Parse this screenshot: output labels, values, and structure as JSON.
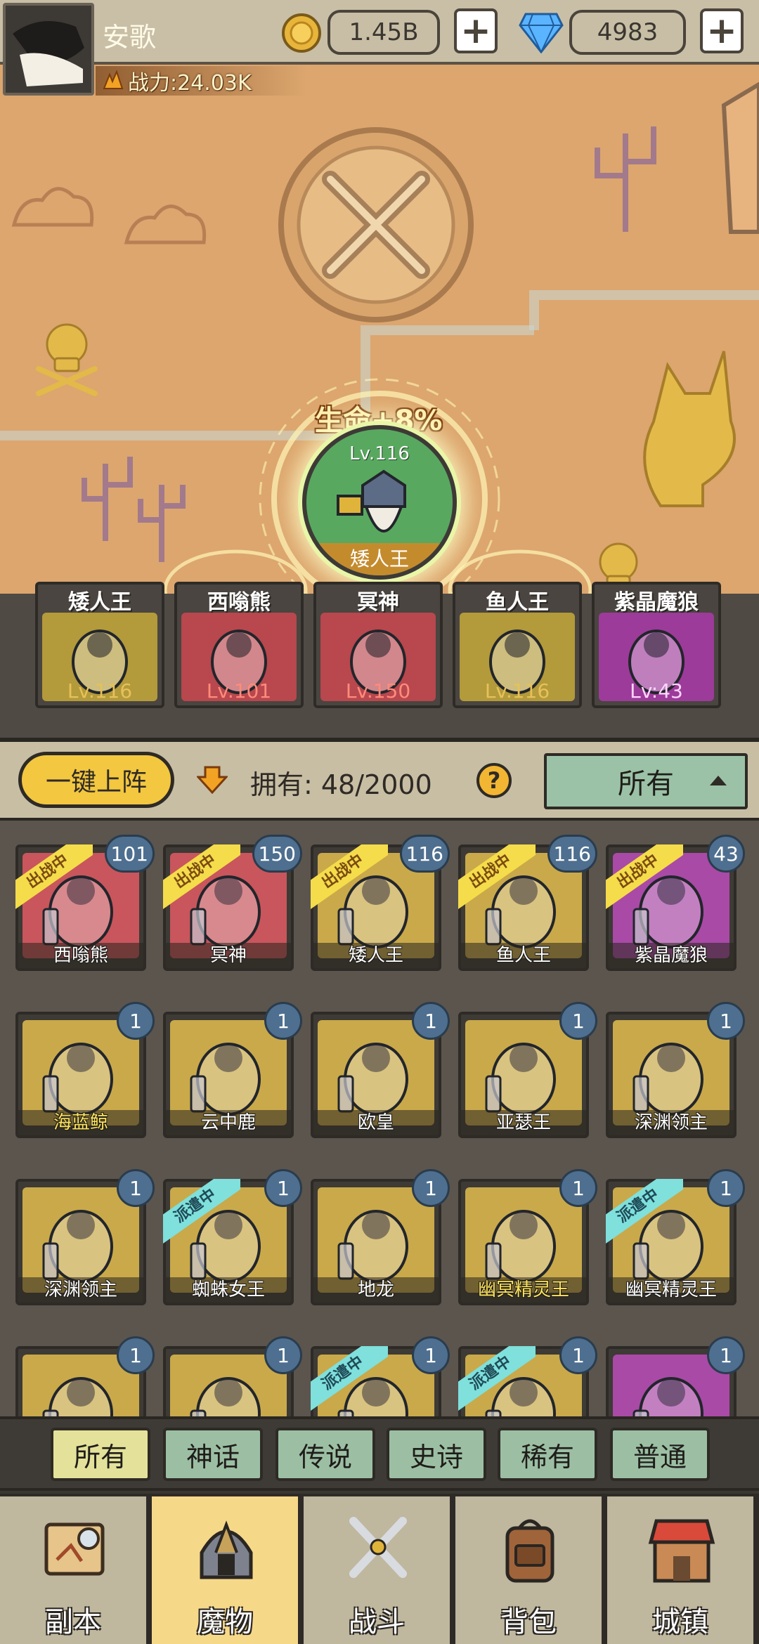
{
  "player": {
    "name": "安歌",
    "power": "战力:24.03K"
  },
  "currency": {
    "gold": "1.45B",
    "gems": "4983",
    "plus": "+"
  },
  "featured": {
    "bonus": "生命+8%",
    "level": "Lv.116",
    "name": "矮人王"
  },
  "team": [
    {
      "name": "矮人王",
      "level": "Lv.116",
      "color": "#b39a3a",
      "lvcolor": "#e6c15a"
    },
    {
      "name": "西嗡熊",
      "level": "Lv.101",
      "color": "#b8474e",
      "lvcolor": "#ff8b7a"
    },
    {
      "name": "冥神",
      "level": "Lv.150",
      "color": "#b8474e",
      "lvcolor": "#ff8b7a"
    },
    {
      "name": "鱼人王",
      "level": "Lv.116",
      "color": "#b39a3a",
      "lvcolor": "#e6c15a"
    },
    {
      "name": "紫晶魔狼",
      "level": "Lv:43",
      "color": "#9c3b99",
      "lvcolor": "#ffd6ff"
    }
  ],
  "controls": {
    "one_key": "一键上阵",
    "owned": "拥有:  48/2000",
    "help": "?",
    "filter": "所有"
  },
  "tags": {
    "battle": "出战中",
    "dispatch": "派遣中"
  },
  "monsters": [
    {
      "name": "西嗡熊",
      "level": "101",
      "tag": "battle",
      "color": "#c8565c",
      "gold": false
    },
    {
      "name": "冥神",
      "level": "150",
      "tag": "battle",
      "color": "#c8565c",
      "gold": false
    },
    {
      "name": "矮人王",
      "level": "116",
      "tag": "battle",
      "color": "#c9a94a",
      "gold": false
    },
    {
      "name": "鱼人王",
      "level": "116",
      "tag": "battle",
      "color": "#c9a94a",
      "gold": false
    },
    {
      "name": "紫晶魔狼",
      "level": "43",
      "tag": "battle",
      "color": "#a94aa6",
      "gold": false
    },
    {
      "name": "海蓝鲸",
      "level": "1",
      "tag": "",
      "color": "#c9a94a",
      "gold": true
    },
    {
      "name": "云中鹿",
      "level": "1",
      "tag": "",
      "color": "#c9a94a",
      "gold": false
    },
    {
      "name": "欧皇",
      "level": "1",
      "tag": "",
      "color": "#c9a94a",
      "gold": false
    },
    {
      "name": "亚瑟王",
      "level": "1",
      "tag": "",
      "color": "#c9a94a",
      "gold": false
    },
    {
      "name": "深渊领主",
      "level": "1",
      "tag": "",
      "color": "#c9a94a",
      "gold": false
    },
    {
      "name": "深渊领主",
      "level": "1",
      "tag": "",
      "color": "#c9a94a",
      "gold": false
    },
    {
      "name": "蜘蛛女王",
      "level": "1",
      "tag": "dispatch",
      "color": "#c9a94a",
      "gold": false
    },
    {
      "name": "地龙",
      "level": "1",
      "tag": "",
      "color": "#c9a94a",
      "gold": false
    },
    {
      "name": "幽冥精灵王",
      "level": "1",
      "tag": "",
      "color": "#c9a94a",
      "gold": true
    },
    {
      "name": "幽冥精灵王",
      "level": "1",
      "tag": "dispatch",
      "color": "#c9a94a",
      "gold": false
    },
    {
      "name": "",
      "level": "1",
      "tag": "",
      "color": "#c9a94a",
      "gold": false
    },
    {
      "name": "",
      "level": "1",
      "tag": "",
      "color": "#c9a94a",
      "gold": false
    },
    {
      "name": "",
      "level": "1",
      "tag": "dispatch",
      "color": "#c9a94a",
      "gold": false
    },
    {
      "name": "",
      "level": "1",
      "tag": "dispatch",
      "color": "#c9a94a",
      "gold": false
    },
    {
      "name": "",
      "level": "1",
      "tag": "",
      "color": "#a94aa6",
      "gold": false
    }
  ],
  "rarity_tabs": [
    "所有",
    "神话",
    "传说",
    "史诗",
    "稀有",
    "普通"
  ],
  "nav": [
    {
      "label": "副本",
      "icon": "map-scroll-icon"
    },
    {
      "label": "魔物",
      "icon": "monster-helmet-icon"
    },
    {
      "label": "战斗",
      "icon": "crossed-swords-icon"
    },
    {
      "label": "背包",
      "icon": "backpack-icon"
    },
    {
      "label": "城镇",
      "icon": "shop-building-icon"
    }
  ],
  "colors": {
    "map_sand": "#dca66e",
    "gold_button": "#f3c73f",
    "teal_button": "#9cbfa4",
    "active_nav": "#f6d889"
  }
}
